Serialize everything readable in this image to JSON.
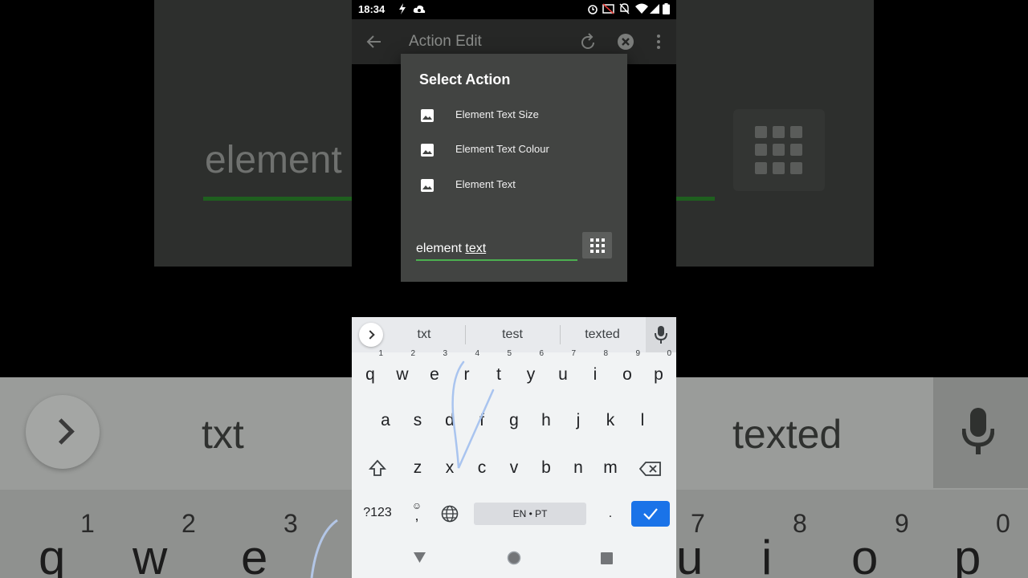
{
  "status_bar": {
    "time": "18:34"
  },
  "app_bar": {
    "title": "Action Edit"
  },
  "dialog": {
    "title": "Select  Action",
    "options": [
      {
        "label": "Element Text Size"
      },
      {
        "label": "Element Text Colour"
      },
      {
        "label": "Element Text"
      }
    ],
    "search": {
      "word1": "element",
      "word2": "text"
    }
  },
  "keyboard": {
    "suggestions": [
      "txt",
      "test",
      "texted"
    ],
    "row1": [
      {
        "key": "q",
        "hint": "1"
      },
      {
        "key": "w",
        "hint": "2"
      },
      {
        "key": "e",
        "hint": "3"
      },
      {
        "key": "r",
        "hint": "4"
      },
      {
        "key": "t",
        "hint": "5"
      },
      {
        "key": "y",
        "hint": "6"
      },
      {
        "key": "u",
        "hint": "7"
      },
      {
        "key": "i",
        "hint": "8"
      },
      {
        "key": "o",
        "hint": "9"
      },
      {
        "key": "p",
        "hint": "0"
      }
    ],
    "row2": [
      "a",
      "s",
      "d",
      "f",
      "g",
      "h",
      "j",
      "k",
      "l"
    ],
    "row3": [
      "z",
      "x",
      "c",
      "v",
      "b",
      "n",
      "m"
    ],
    "symbols_label": "?123",
    "emoji_comma_top": "☺",
    "comma": ",",
    "space_label": "EN • PT",
    "period": "."
  },
  "background_zoom": {
    "input_text": "element",
    "suggestions": [
      "txt",
      "texted"
    ],
    "hints": [
      "1",
      "2",
      "3",
      "7",
      "8",
      "9",
      "0"
    ],
    "letters": [
      "q",
      "w",
      "e",
      "u",
      "i",
      "o",
      "p"
    ]
  },
  "colors": {
    "accent_green": "#4caf50",
    "enter_blue": "#1a73e8",
    "dialog_bg": "#424442",
    "keyboard_bg": "#f1f3f4",
    "swipe_trail": "#a9c4ef"
  }
}
